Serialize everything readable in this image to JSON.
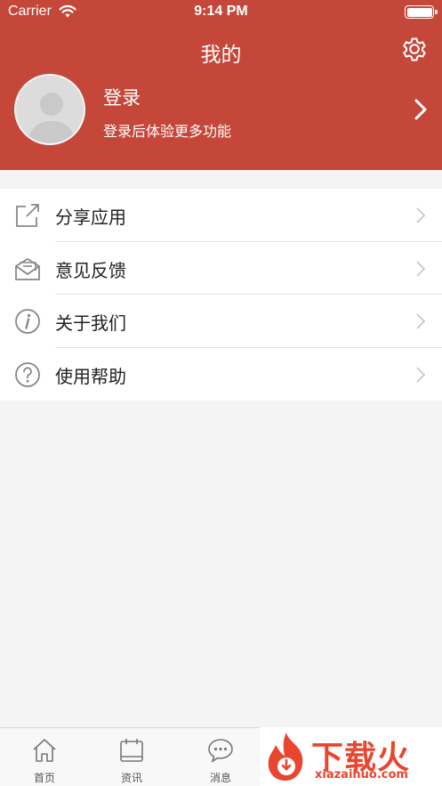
{
  "status_bar": {
    "carrier": "Carrier",
    "time": "9:14 PM"
  },
  "header": {
    "title": "我的"
  },
  "profile": {
    "title": "登录",
    "subtitle": "登录后体验更多功能"
  },
  "menu": [
    {
      "label": "分享应用",
      "icon": "share-icon"
    },
    {
      "label": "意见反馈",
      "icon": "feedback-mail-icon"
    },
    {
      "label": "关于我们",
      "icon": "info-icon"
    },
    {
      "label": "使用帮助",
      "icon": "help-icon"
    }
  ],
  "tabs": [
    {
      "label": "首页",
      "icon": "home-icon"
    },
    {
      "label": "资讯",
      "icon": "calendar-icon"
    },
    {
      "label": "消息",
      "icon": "chat-bubble-icon"
    }
  ],
  "watermark": {
    "text": "下载火",
    "url": "xiazaihuo.com"
  },
  "colors": {
    "header_bg": "#c5473a",
    "page_bg": "#f4f4f4",
    "watermark": "#e8462f"
  }
}
